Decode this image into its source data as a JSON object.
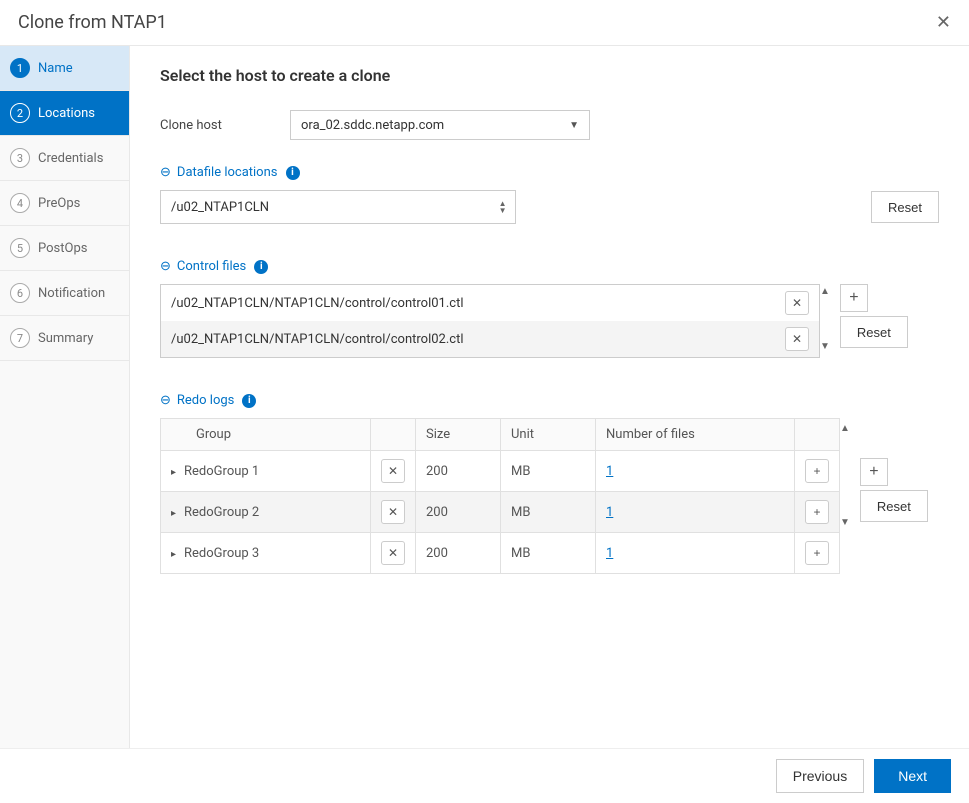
{
  "header": {
    "title": "Clone from NTAP1"
  },
  "sidebar": {
    "steps": [
      {
        "num": "1",
        "label": "Name"
      },
      {
        "num": "2",
        "label": "Locations"
      },
      {
        "num": "3",
        "label": "Credentials"
      },
      {
        "num": "4",
        "label": "PreOps"
      },
      {
        "num": "5",
        "label": "PostOps"
      },
      {
        "num": "6",
        "label": "Notification"
      },
      {
        "num": "7",
        "label": "Summary"
      }
    ]
  },
  "main": {
    "title": "Select the host to create a clone",
    "clone_host": {
      "label": "Clone host",
      "value": "ora_02.sddc.netapp.com"
    },
    "datafile": {
      "section_label": "Datafile locations",
      "value": "/u02_NTAP1CLN",
      "reset": "Reset"
    },
    "control_files": {
      "section_label": "Control files",
      "items": [
        "/u02_NTAP1CLN/NTAP1CLN/control/control01.ctl",
        "/u02_NTAP1CLN/NTAP1CLN/control/control02.ctl"
      ],
      "reset": "Reset"
    },
    "redo_logs": {
      "section_label": "Redo logs",
      "headers": {
        "group": "Group",
        "size": "Size",
        "unit": "Unit",
        "numfiles": "Number of files"
      },
      "rows": [
        {
          "group": "RedoGroup 1",
          "size": "200",
          "unit": "MB",
          "numfiles": "1"
        },
        {
          "group": "RedoGroup 2",
          "size": "200",
          "unit": "MB",
          "numfiles": "1"
        },
        {
          "group": "RedoGroup 3",
          "size": "200",
          "unit": "MB",
          "numfiles": "1"
        }
      ],
      "reset": "Reset"
    }
  },
  "footer": {
    "previous": "Previous",
    "next": "Next"
  }
}
